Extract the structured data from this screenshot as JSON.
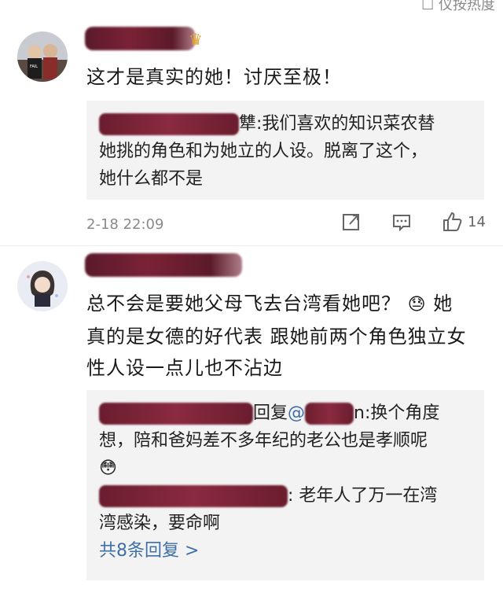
{
  "top_partial": "☐ 仪按热度",
  "comments": [
    {
      "text": "这才是真实的她！讨厌至极！",
      "quote_suffix_1": "犨:",
      "quote_line_1": "我们喜欢的知识菜农替",
      "quote_line_2": "她挑的角色和为她立的人设。脱离了这个，",
      "quote_line_3": "她什么都不是",
      "time": "2-18 22:09",
      "like_count": "14"
    },
    {
      "text_line_1": "总不会是要她父母飞去台湾看她吧？",
      "text_line_2_suffix": "她",
      "text_line_3": "真的是女德的好代表 跟她前两个角色独立女",
      "text_line_4": "性人设一点儿也不沾边",
      "reply1_mid": "回复",
      "reply1_at": "@",
      "reply1_after": "n:换个角度",
      "reply1_line2": "想，陪和爸妈差不多年纪的老公也是孝顺呢",
      "reply2_after": ": 老年人了万一在湾",
      "reply2_line2": "湾感染，要命啊",
      "more_replies": "共8条回复 >"
    }
  ],
  "icons": {
    "share": "share-icon",
    "comment": "comment-icon",
    "like": "thumbs-up-icon",
    "crown": "crown-icon",
    "emoji1": "sweat-emoji-icon",
    "emoji2": "shy-emoji-icon"
  }
}
